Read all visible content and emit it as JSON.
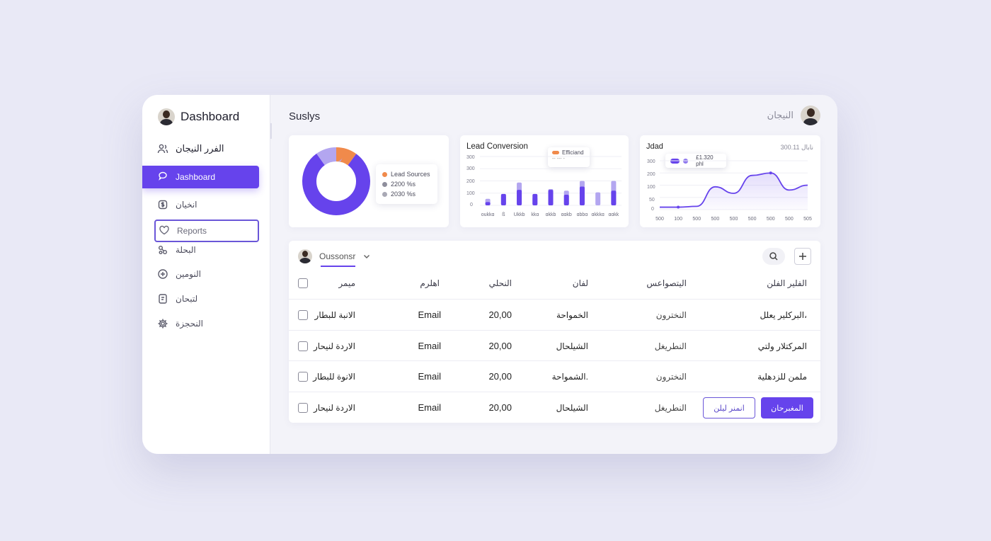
{
  "colors": {
    "accent": "#6643ec",
    "accent_light": "#b3a6f0",
    "orange": "#f08a4b",
    "gray": "#9a9aa8"
  },
  "sidebar": {
    "brand": "Dashboard",
    "items": [
      {
        "label": "الفرر النيجان",
        "icon": "users-icon"
      },
      {
        "label": "Jashboard",
        "icon": "chat-icon",
        "active": true
      },
      {
        "label": "انخيان",
        "icon": "dollar-icon"
      },
      {
        "label": "Reports",
        "icon": "heart-icon",
        "outlined": true
      },
      {
        "label": "البحلة",
        "icon": "link-icon"
      },
      {
        "label": "النومين",
        "icon": "plus-circle-icon"
      },
      {
        "label": "لتبحان",
        "icon": "document-icon"
      },
      {
        "label": "النحجزة",
        "icon": "gear-icon"
      }
    ]
  },
  "header": {
    "title": "Suslys",
    "user_name": "النيجان"
  },
  "donut_card": {
    "legend": [
      "Lead Sources",
      "2200 %s",
      "2030 %s"
    ]
  },
  "bar_card": {
    "title": "Lead Conversion",
    "tooltip": "Efficiand",
    "tooltip_sub": "-- --- -",
    "yticks": [
      "300",
      "300",
      "200",
      "100",
      "0"
    ]
  },
  "line_card": {
    "title": "Jdad",
    "subtitle": "نابال 300.11",
    "tooltip": "£1.320 phl",
    "yticks": [
      "300",
      "200",
      "100",
      "50",
      "0"
    ]
  },
  "chart_data": [
    {
      "type": "pie",
      "labels": [
        "Lead Sources",
        "2200 %s",
        "2030 %s"
      ],
      "values": [
        10,
        80,
        10
      ]
    },
    {
      "type": "bar",
      "title": "Lead Conversion",
      "categories": [
        "oukkɑ",
        "ß",
        "Ukkb",
        "kkɑ",
        "ɑkkb",
        "ɑɑkb",
        "ɑbbɑ",
        "ɑkkkɑ",
        "ɑɑkk"
      ],
      "series": [
        {
          "name": "Efficiand",
          "values": [
            20,
            70,
            95,
            70,
            95,
            65,
            115,
            0,
            90
          ]
        },
        {
          "values": [
            40,
            60,
            140,
            50,
            100,
            90,
            150,
            80,
            150
          ]
        }
      ],
      "ylim": [
        0,
        300
      ]
    },
    {
      "type": "area",
      "title": "Jdad",
      "x": [
        "500",
        "100",
        "500",
        "500",
        "500",
        "500",
        "500",
        "500",
        "505"
      ],
      "y": [
        15,
        15,
        20,
        140,
        100,
        210,
        225,
        120,
        150
      ],
      "ylim": [
        0,
        300
      ]
    }
  ],
  "table": {
    "user_filter": "Oussonsr",
    "headers": [
      "ميمر",
      "اهلرم",
      "النحلي",
      "لفان",
      "اليتصواعس",
      "الفلير الفلن"
    ],
    "rows": [
      [
        "الانبة للبطار",
        "Email",
        "20,00",
        "الخمواحة",
        "النخترون",
        "البركلير يعلل،"
      ],
      [
        "الاردة لنيحار",
        "Email",
        "20,00",
        "الشيلحال",
        "النطريغل",
        "المركتلار ولتي"
      ],
      [
        "الانوة للبطار",
        "Email",
        "20,00",
        "الشمواحة.",
        "النخترون",
        "ملمن للزدهلية"
      ],
      [
        "الاردة لنيحار",
        "Email",
        "20,00",
        "الشيلحال",
        "النطريغل",
        ""
      ]
    ],
    "action_outline": "انمنر ليلن",
    "action_filled": "المغبرحان"
  }
}
